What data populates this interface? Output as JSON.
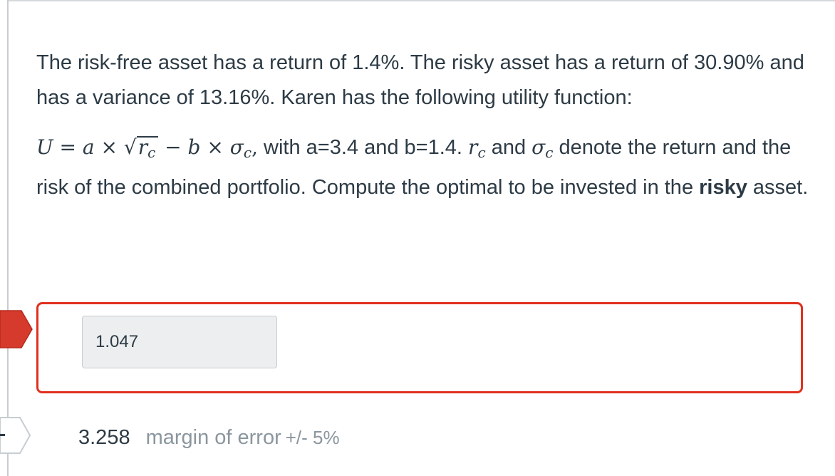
{
  "question": {
    "line1": "The risk-free asset has a return of 1.4%.  The risky asset has a return of 30.90% and has a variance of 13.16%.  Karen has the following utility function:",
    "formula_U": "U",
    "formula_eq": " = ",
    "formula_a": "a",
    "formula_times1": " × ",
    "formula_r": "r",
    "formula_c": "c",
    "formula_minus": " − ",
    "formula_b": "b",
    "formula_times2": " × ",
    "formula_sigma": "σ",
    "formula_c2": "c",
    "formula_comma": ",",
    "text_with": " with a=3.4 and b=1.4. ",
    "text_rc_r": "r",
    "text_rc_c": "c",
    "text_and": " and ",
    "text_sigma": "σ",
    "text_sigma_c": "c",
    "text_tail": " denote the return and the risk of the combined portfolio. Compute the optimal to be invested in the ",
    "text_bold": "risky",
    "text_end": " asset."
  },
  "answer": {
    "value": "1.047"
  },
  "correct": {
    "value": "3.258",
    "margin_label": "margin of error",
    "margin_value": "+/- 5%"
  },
  "colors": {
    "incorrect": "#e0301e",
    "text": "#2d3b45",
    "muted": "#8b969e"
  }
}
